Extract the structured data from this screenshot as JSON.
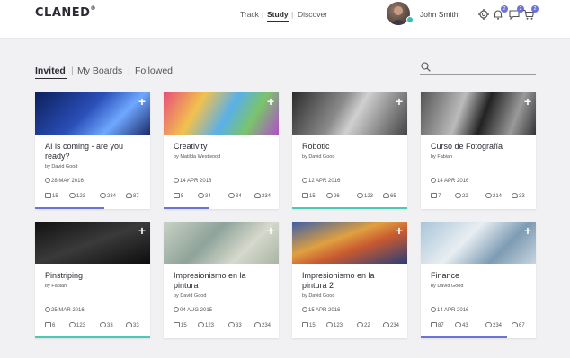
{
  "app": {
    "logo": "CLANED",
    "logo_mark": "®"
  },
  "nav": {
    "track": "Track",
    "study": "Study",
    "discover": "Discover"
  },
  "user": {
    "name": "John Smith"
  },
  "header_icons": [
    {
      "name": "gear-icon",
      "badge": ""
    },
    {
      "name": "bell-icon",
      "badge": "2"
    },
    {
      "name": "chat-icon",
      "badge": "2"
    },
    {
      "name": "cart-icon",
      "badge": "2"
    }
  ],
  "tabs": {
    "invited": "Invited",
    "my_boards": "My Boards",
    "followed": "Followed"
  },
  "search": {
    "placeholder": ""
  },
  "colors": {
    "accent_blue": "#6b73d6",
    "accent_teal": "#4ac9b4"
  },
  "cards": [
    {
      "title": "AI is coming - are you ready?",
      "author": "by David Good",
      "date": "28 MAY 2016",
      "s1": "15",
      "s2": "123",
      "s3": "234",
      "s4": "87",
      "progress": 0.6,
      "bar": "blue"
    },
    {
      "title": "Creativity",
      "author": "by Matilda Westwood",
      "date": "14 APR 2016",
      "s1": "5",
      "s2": "34",
      "s3": "34",
      "s4": "234",
      "progress": 0.4,
      "bar": "blue"
    },
    {
      "title": "Robotic",
      "author": "by David Good",
      "date": "12 APR 2016",
      "s1": "15",
      "s2": "26",
      "s3": "123",
      "s4": "65",
      "progress": 1.0,
      "bar": "teal"
    },
    {
      "title": "Curso de Fotografía",
      "author": "by Fabian",
      "date": "14 APR 2016",
      "s1": "7",
      "s2": "22",
      "s3": "214",
      "s4": "33",
      "progress": 0,
      "bar": ""
    },
    {
      "title": "Pinstriping",
      "author": "by Fabian",
      "date": "25 MAR 2016",
      "s1": "6",
      "s2": "123",
      "s3": "33",
      "s4": "33",
      "progress": 1.0,
      "bar": "teal"
    },
    {
      "title": "Impresionismo en la pintura",
      "author": "by David Good",
      "date": "04 AUG 2015",
      "s1": "15",
      "s2": "123",
      "s3": "33",
      "s4": "234",
      "progress": 0,
      "bar": ""
    },
    {
      "title": "Impresionismo en la pintura 2",
      "author": "by David Good",
      "date": "15 APR 2016",
      "s1": "15",
      "s2": "123",
      "s3": "22",
      "s4": "234",
      "progress": 0,
      "bar": ""
    },
    {
      "title": "Finance",
      "author": "by David Good",
      "date": "14 APR 2016",
      "s1": "87",
      "s2": "43",
      "s3": "234",
      "s4": "67",
      "progress": 0.75,
      "bar": "blue"
    }
  ]
}
